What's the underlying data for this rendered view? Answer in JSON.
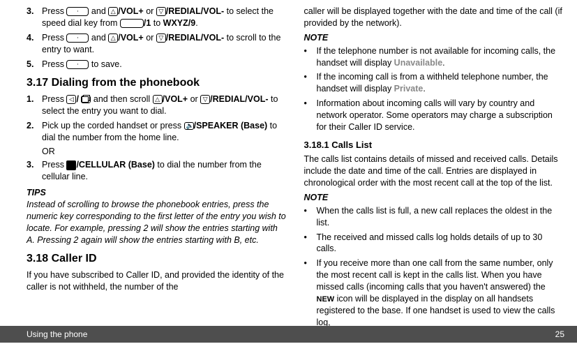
{
  "footer": {
    "title": "Using the phone",
    "page": "25"
  },
  "L": {
    "s3": {
      "a": "Press ",
      "b": " and ",
      "c": "/VOL+",
      "d": " or ",
      "e": "/REDIAL/VOL-",
      "f": " to select the speed dial key from ",
      "g": "/1",
      "h": " to ",
      "i": "WXYZ/9",
      "j": "."
    },
    "s4": {
      "a": "Press ",
      "b": " and ",
      "c": "/VOL+",
      "d": " or ",
      "e": "/REDIAL/VOL-",
      "f": " to scroll to the entry to want."
    },
    "s5": {
      "a": "Press ",
      "b": " to save."
    },
    "h317": "3.17    Dialing from the phonebook",
    "p1": {
      "a": "Press ",
      "b": "/ ",
      "c": " and then scroll ",
      "d": "/VOL+",
      "e": " or ",
      "f": "/",
      "g": "REDIAL/VOL-",
      "h": " to select the entry you want to dial."
    },
    "p2": {
      "a": "Pick up the corded handset or press ",
      "b": "/",
      "c": "SPEAKER (Base)",
      "d": " to dial the number from the home line."
    },
    "or": "OR",
    "p3": {
      "a": "Press ",
      "b": "/CELLULAR (Base)",
      "c": " to dial the number from the cellular line."
    },
    "tipsH": "TIPS",
    "tipsB": "Instead of scrolling to browse the phonebook entries, press the numeric key corresponding to the first letter of the entry you wish to locate. For example, pressing 2 will show the entries starting with A. Pressing 2 again will show the entries starting with B, etc.",
    "h318": "3.18    Caller ID",
    "cid": "If you have subscribed to Caller ID, and provided the identity of the caller is not withheld, the number of the"
  },
  "R": {
    "top": "caller will be displayed together with the date and time of the call (if provided by the network).",
    "noteH": "NOTE",
    "n1": {
      "a": "If the telephone number is not available for incoming calls, the handset will display ",
      "b": "Unavailable",
      "c": "."
    },
    "n2": {
      "a": "If the incoming call is from a withheld telephone number, the handset will display ",
      "b": "Private",
      "c": "."
    },
    "n3": "Information about incoming calls will vary by country and network operator. Some operators may charge a subscription for their Caller ID service.",
    "h3181": "3.18.1   Calls List",
    "cl": "The calls list contains details of missed and received calls. Details include the date and time of the call. Entries are displayed in chronological order with the most recent call at the top of the list.",
    "m1": "When the calls list is full, a new call replaces the oldest in the list.",
    "m2": "The received and missed calls log holds details of up to 30 calls.",
    "m3a": "If you receive more than one call from the same number, only the most recent call is kept in the calls list. When you have missed calls (incoming calls that you haven't answered) the ",
    "m3b": "NEW",
    "m3c": " icon will be displayed in the display on all handsets registered to the base. If one handset is used to view the calls log,"
  }
}
